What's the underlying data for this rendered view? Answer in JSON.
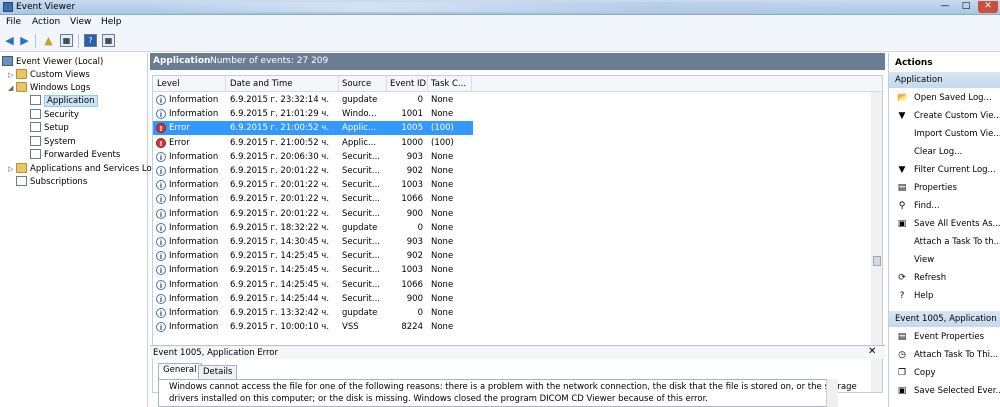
{
  "window": {
    "title": "Event Viewer"
  },
  "menu": [
    "File",
    "Action",
    "View",
    "Help"
  ],
  "tree": [
    {
      "label": "Event Viewer (Local)",
      "expander": "",
      "icon": "comp"
    },
    {
      "label": "Custom Views",
      "expander": "▷",
      "icon": "folder"
    },
    {
      "label": "Windows Logs",
      "expander": "◢",
      "icon": "folder"
    },
    {
      "label": "Application",
      "expander": "",
      "icon": "log",
      "selected": true
    },
    {
      "label": "Security",
      "expander": "",
      "icon": "log"
    },
    {
      "label": "Setup",
      "expander": "",
      "icon": "log"
    },
    {
      "label": "System",
      "expander": "",
      "icon": "log"
    },
    {
      "label": "Forwarded Events",
      "expander": "",
      "icon": "log"
    },
    {
      "label": "Applications and Services Lo",
      "expander": "▷",
      "icon": "folder"
    },
    {
      "label": "Subscriptions",
      "expander": "",
      "icon": "log"
    }
  ],
  "main": {
    "title": "Application",
    "count_text": "Number of events: 27 209",
    "columns": [
      "Level",
      "Date and Time",
      "Source",
      "Event ID",
      "Task C..."
    ],
    "rows": [
      {
        "level": "Information",
        "date": "6.9.2015 г. 23:32:14 ч.",
        "source": "gupdate",
        "id": "0",
        "task": "None"
      },
      {
        "level": "Information",
        "date": "6.9.2015 г. 21:01:29 ч.",
        "source": "Windo...",
        "id": "1001",
        "task": "None"
      },
      {
        "level": "Error",
        "date": "6.9.2015 г. 21:00:52 ч.",
        "source": "Applic...",
        "id": "1005",
        "task": "(100)",
        "selected": true
      },
      {
        "level": "Error",
        "date": "6.9.2015 г. 21:00:52 ч.",
        "source": "Applic...",
        "id": "1000",
        "task": "(100)"
      },
      {
        "level": "Information",
        "date": "6.9.2015 г. 20:06:30 ч.",
        "source": "Securit...",
        "id": "903",
        "task": "None"
      },
      {
        "level": "Information",
        "date": "6.9.2015 г. 20:01:22 ч.",
        "source": "Securit...",
        "id": "902",
        "task": "None"
      },
      {
        "level": "Information",
        "date": "6.9.2015 г. 20:01:22 ч.",
        "source": "Securit...",
        "id": "1003",
        "task": "None"
      },
      {
        "level": "Information",
        "date": "6.9.2015 г. 20:01:22 ч.",
        "source": "Securit...",
        "id": "1066",
        "task": "None"
      },
      {
        "level": "Information",
        "date": "6.9.2015 г. 20:01:22 ч.",
        "source": "Securit...",
        "id": "900",
        "task": "None"
      },
      {
        "level": "Information",
        "date": "6.9.2015 г. 18:32:22 ч.",
        "source": "gupdate",
        "id": "0",
        "task": "None"
      },
      {
        "level": "Information",
        "date": "6.9.2015 г. 14:30:45 ч.",
        "source": "Securit...",
        "id": "903",
        "task": "None"
      },
      {
        "level": "Information",
        "date": "6.9.2015 г. 14:25:45 ч.",
        "source": "Securit...",
        "id": "902",
        "task": "None"
      },
      {
        "level": "Information",
        "date": "6.9.2015 г. 14:25:45 ч.",
        "source": "Securit...",
        "id": "1003",
        "task": "None"
      },
      {
        "level": "Information",
        "date": "6.9.2015 г. 14:25:45 ч.",
        "source": "Securit...",
        "id": "1066",
        "task": "None"
      },
      {
        "level": "Information",
        "date": "6.9.2015 г. 14:25:44 ч.",
        "source": "Securit...",
        "id": "900",
        "task": "None"
      },
      {
        "level": "Information",
        "date": "6.9.2015 г. 13:32:42 ч.",
        "source": "gupdate",
        "id": "0",
        "task": "None"
      },
      {
        "level": "Information",
        "date": "6.9.2015 г. 10:00:10 ч.",
        "source": "VSS",
        "id": "8224",
        "task": "None"
      }
    ]
  },
  "detail": {
    "title": "Event 1005, Application Error",
    "tabs": [
      "General",
      "Details"
    ],
    "lines": [
      "Windows cannot access the file  for one of the following reasons: there is a problem with the network connection, the disk that the file is stored on, or the storage",
      "drivers installed on this computer; or the disk is missing. Windows closed the program DICOM CD Viewer because of this error."
    ]
  },
  "actions": {
    "header": "Actions",
    "section1": "Application",
    "items1": [
      {
        "label": "Open Saved Log...",
        "icon": "folder-open-icon",
        "glyph": "📂"
      },
      {
        "label": "Create Custom Vie...",
        "icon": "filter-icon",
        "glyph": "▼"
      },
      {
        "label": "Import Custom Vie...",
        "icon": "",
        "glyph": ""
      },
      {
        "label": "Clear Log...",
        "icon": "",
        "glyph": ""
      },
      {
        "label": "Filter Current Log...",
        "icon": "filter-icon",
        "glyph": "▼"
      },
      {
        "label": "Properties",
        "icon": "properties-icon",
        "glyph": "▤"
      },
      {
        "label": "Find...",
        "icon": "find-icon",
        "glyph": "⚲"
      },
      {
        "label": "Save All Events As...",
        "icon": "save-icon",
        "glyph": "▣"
      },
      {
        "label": "Attach a Task To th...",
        "icon": "",
        "glyph": ""
      },
      {
        "label": "View",
        "icon": "",
        "glyph": ""
      },
      {
        "label": "Refresh",
        "icon": "refresh-icon",
        "glyph": "⟳"
      },
      {
        "label": "Help",
        "icon": "help-icon",
        "glyph": "?"
      }
    ],
    "section2": "Event 1005, Application ...",
    "items2": [
      {
        "label": "Event Properties",
        "icon": "properties-icon",
        "glyph": "▤"
      },
      {
        "label": "Attach Task To Thi...",
        "icon": "task-icon",
        "glyph": "◷"
      },
      {
        "label": "Copy",
        "icon": "copy-icon",
        "glyph": "❐"
      },
      {
        "label": "Save Selected Ever...",
        "icon": "save-icon",
        "glyph": "▣"
      }
    ]
  },
  "colors": {
    "selection": "#3399ff",
    "header": "#6b7d94",
    "section": "#c4d8ee"
  }
}
